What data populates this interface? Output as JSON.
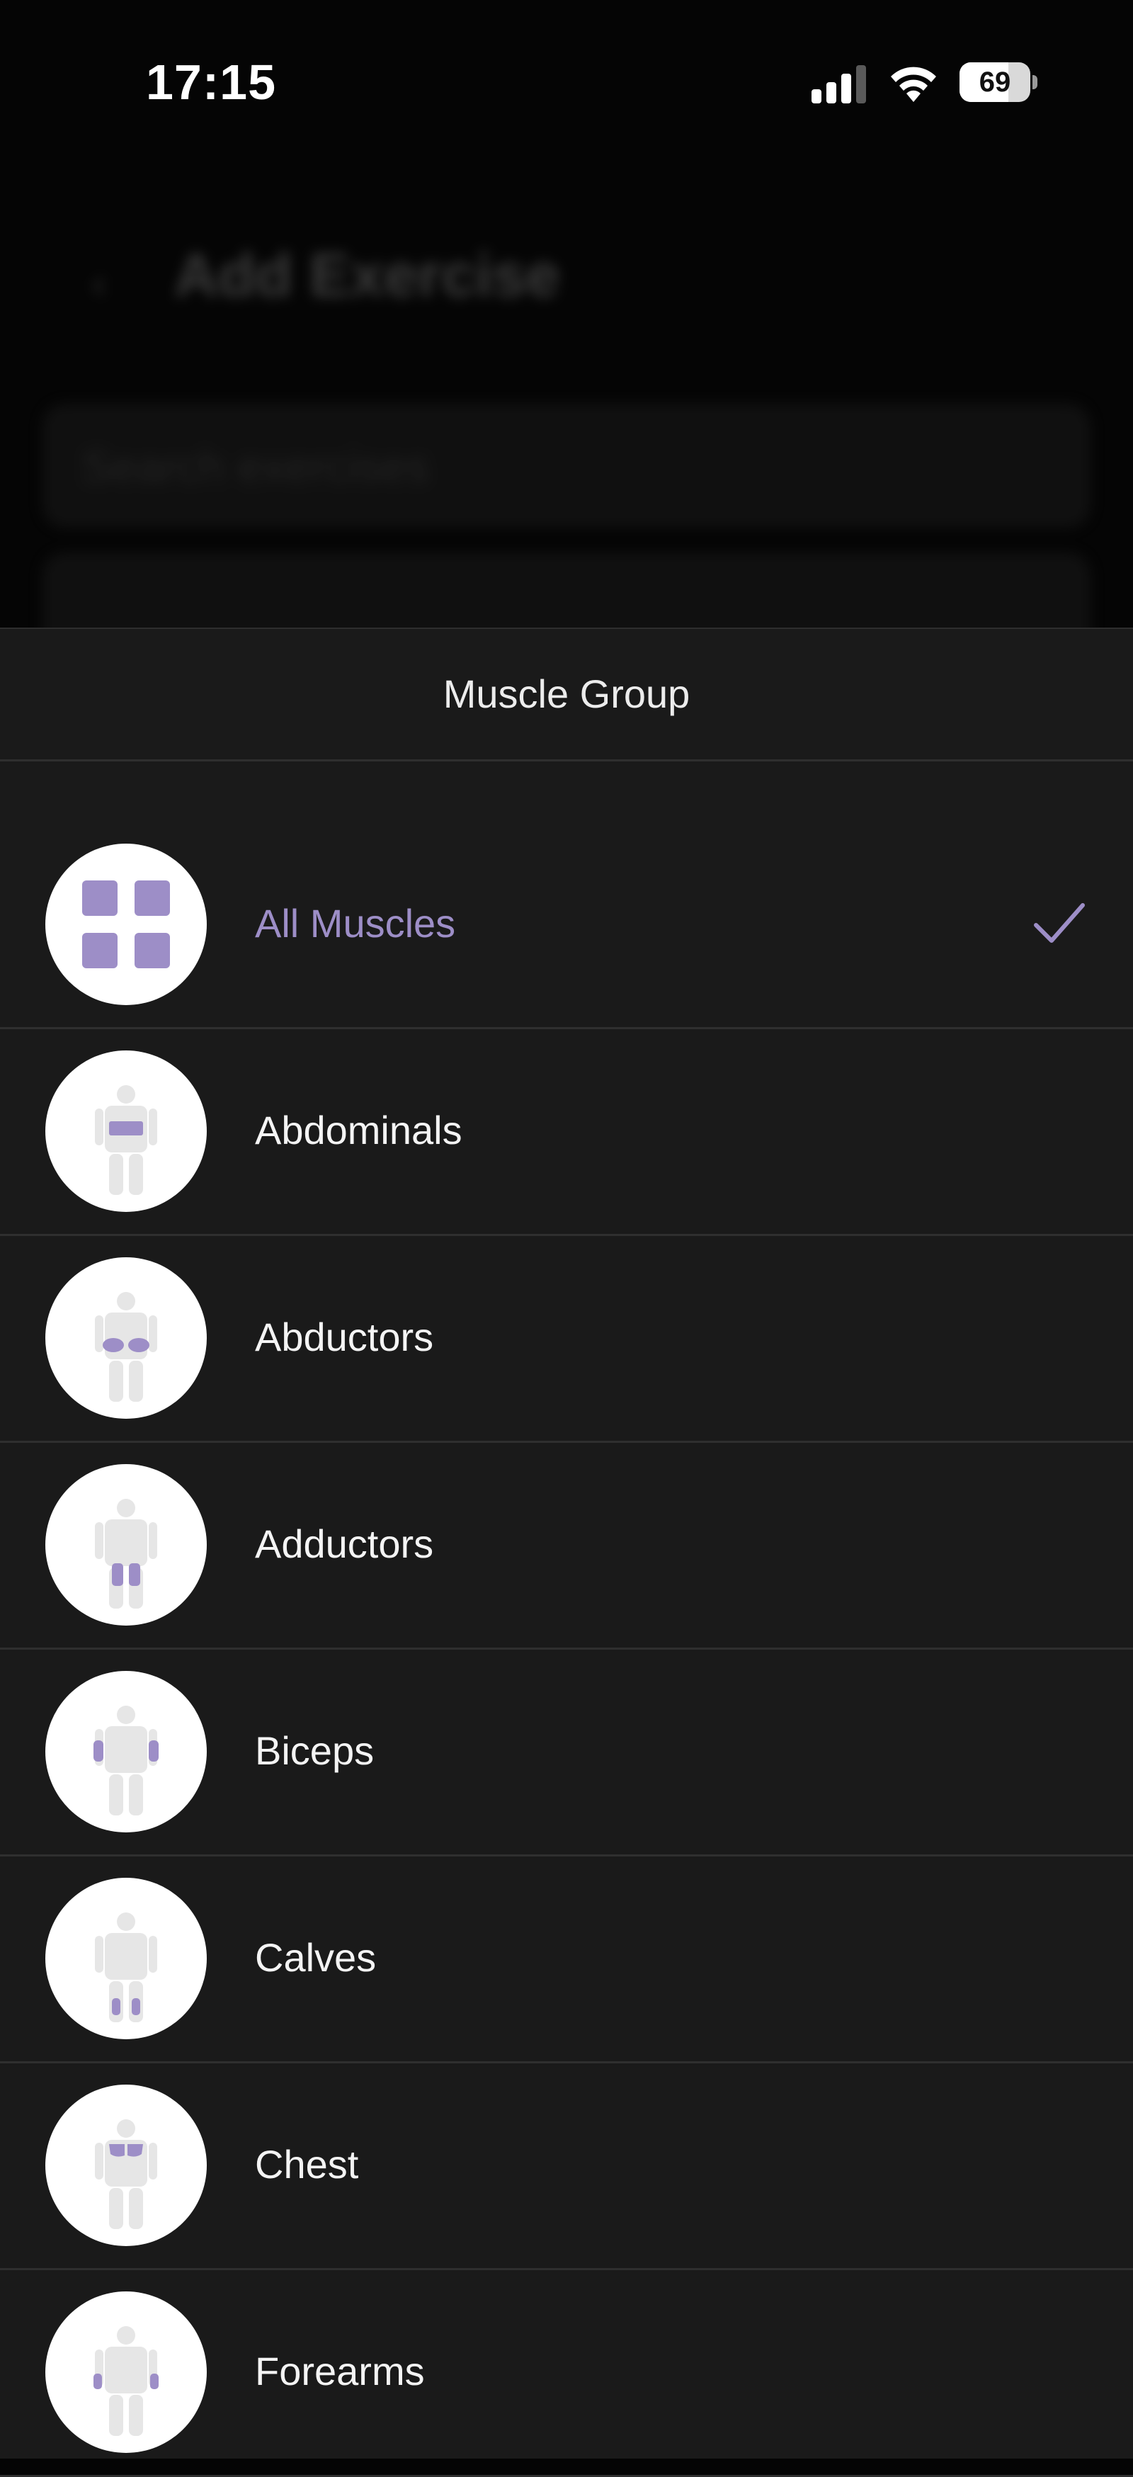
{
  "status_bar": {
    "time": "17:15",
    "battery_level": "69",
    "battery_fraction": 0.69
  },
  "background_screen": {
    "title": "Add Exercise",
    "search_placeholder": "Search exercises"
  },
  "sheet": {
    "title": "Muscle Group",
    "accent_color": "#9d8ec7",
    "items": [
      {
        "label": "All Muscles",
        "icon": "grid-icon",
        "selected": true
      },
      {
        "label": "Abdominals",
        "icon": "abdominals-body-icon"
      },
      {
        "label": "Abductors",
        "icon": "abductors-body-icon"
      },
      {
        "label": "Adductors",
        "icon": "adductors-body-icon"
      },
      {
        "label": "Biceps",
        "icon": "biceps-body-icon"
      },
      {
        "label": "Calves",
        "icon": "calves-body-icon"
      },
      {
        "label": "Chest",
        "icon": "chest-body-icon"
      },
      {
        "label": "Forearms",
        "icon": "forearms-body-icon"
      }
    ]
  }
}
